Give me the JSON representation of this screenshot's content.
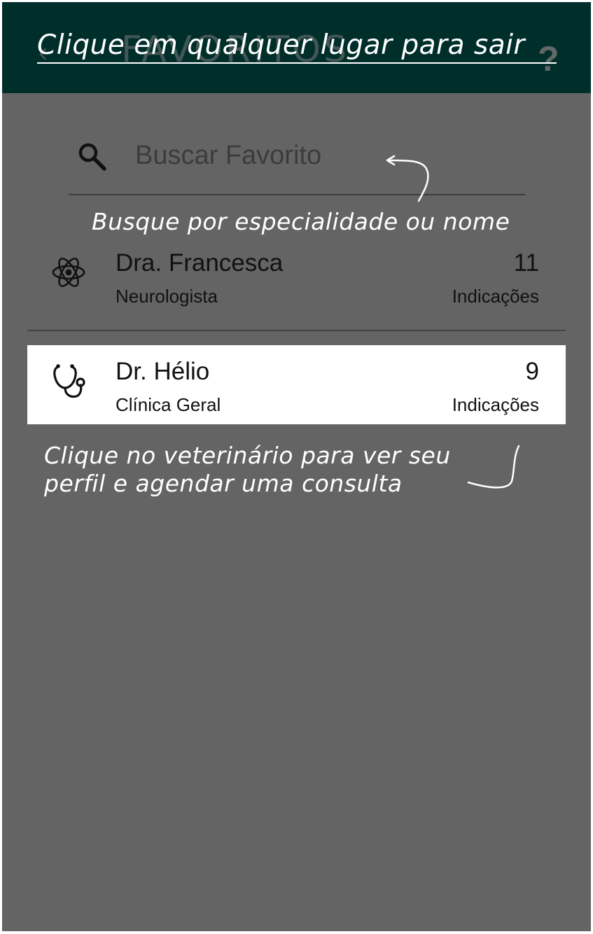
{
  "appbar": {
    "title": "FAVORITOS",
    "back_icon": "back-arrow-icon",
    "help_icon": "help-icon",
    "help_label": "?"
  },
  "overlay": {
    "exit_hint": "Clique em qualquer lugar para sair",
    "search_hint": "Busque por especialidade ou nome",
    "vet_hint_line1": "Clique no veterinário para ver seu",
    "vet_hint_line2": "perfil e agendar uma consulta"
  },
  "search": {
    "placeholder": "Buscar Favorito",
    "icon": "search-icon"
  },
  "favorites": [
    {
      "name": "Dra. Francesca",
      "specialty": "Neurologista",
      "count": "11",
      "count_label": "Indicações",
      "icon": "atom-icon"
    },
    {
      "name": "Dr. Hélio",
      "specialty": "Clínica Geral",
      "count": "9",
      "count_label": "Indicações",
      "icon": "stethoscope-icon"
    }
  ],
  "colors": {
    "appbar": "#002e2b",
    "overlay": "#646464",
    "highlight": "#ffffff"
  }
}
